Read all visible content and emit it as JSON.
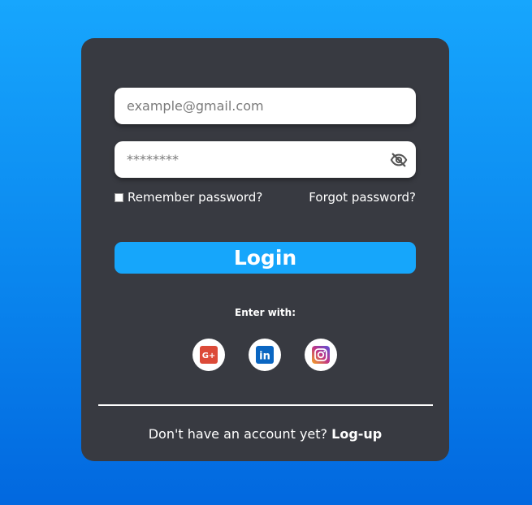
{
  "login_form": {
    "email_placeholder": "example@gmail.com",
    "password_placeholder": "********",
    "password_visibility_icon": "eye-off-icon",
    "remember_label": "Remember password?",
    "forgot_label": "Forgot password?",
    "login_label": "Login",
    "enter_with_label": "Enter with:",
    "social": [
      {
        "name": "google-plus",
        "icon": "google-plus-icon",
        "color": "#dc4a38",
        "glyph": "G+"
      },
      {
        "name": "linkedin",
        "icon": "linkedin-icon",
        "color": "#0a66c2",
        "glyph": "in"
      },
      {
        "name": "instagram",
        "icon": "instagram-icon",
        "color": "#c13584"
      }
    ],
    "signup_prompt": "Don't have an account yet?",
    "signup_link": "Log-up"
  },
  "colors": {
    "background_top": "#17a6fd",
    "background_bottom": "#0268df",
    "card": "#383a41",
    "accent": "#16a6fb"
  }
}
